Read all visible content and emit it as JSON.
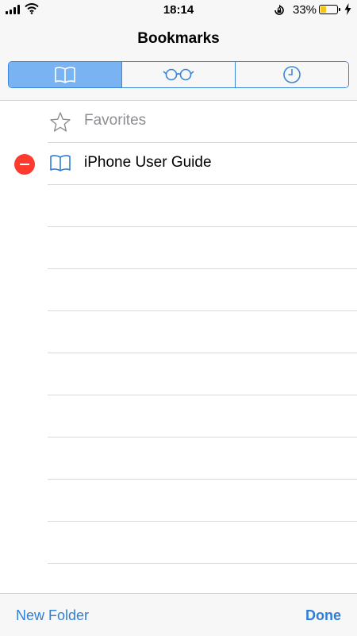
{
  "status_bar": {
    "time": "18:14",
    "battery_percent": "33%",
    "battery_level": 0.33,
    "battery_color": "#f5c518",
    "icons": [
      "cellular-signal-icon",
      "wifi-icon",
      "rotation-lock-icon",
      "battery-icon",
      "charging-bolt-icon"
    ]
  },
  "header": {
    "title": "Bookmarks",
    "tabs": [
      {
        "name": "bookmarks",
        "icon": "book-icon",
        "active": true
      },
      {
        "name": "reading-list",
        "icon": "glasses-icon",
        "active": false
      },
      {
        "name": "history",
        "icon": "clock-icon",
        "active": false
      }
    ]
  },
  "list": {
    "items": [
      {
        "label": "Favorites",
        "icon": "star-icon",
        "editable": false
      },
      {
        "label": "iPhone User Guide",
        "icon": "book-icon",
        "editable": true
      }
    ]
  },
  "toolbar": {
    "new_folder_label": "New Folder",
    "done_label": "Done"
  },
  "colors": {
    "accent": "#2f7ed8",
    "segment_active": "#7ab3f2",
    "delete": "#ff3b30"
  }
}
